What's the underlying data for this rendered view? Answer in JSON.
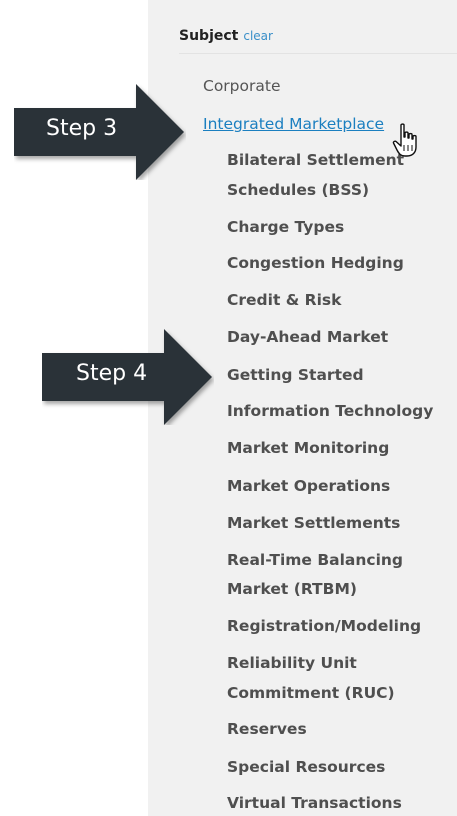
{
  "subject": {
    "title": "Subject",
    "clear_label": "clear"
  },
  "items": {
    "corporate": "Corporate",
    "integrated_marketplace": "Integrated Marketplace",
    "bss_line1": "Bilateral Settlement",
    "bss_line2": "Schedules (BSS)",
    "charge_types": "Charge Types",
    "congestion_hedging": "Congestion Hedging",
    "credit_risk": "Credit & Risk",
    "day_ahead": "Day-Ahead Market",
    "getting_started": "Getting Started",
    "info_tech": "Information Technology",
    "market_monitoring": "Market Monitoring",
    "market_operations": "Market Operations",
    "market_settlements": "Market Settlements",
    "rtbm_line1": "Real-Time Balancing",
    "rtbm_line2": "Market (RTBM)",
    "registration": "Registration/Modeling",
    "ruc_line1": "Reliability Unit",
    "ruc_line2": "Commitment (RUC)",
    "reserves": "Reserves",
    "special_resources": "Special Resources",
    "virtual_transactions": "Virtual Transactions"
  },
  "callouts": {
    "step3": "Step 3",
    "step4": "Step 4"
  },
  "colors": {
    "link": "#1b7fc0",
    "callout": "#2b3339",
    "panel_bg": "#f1f1f1"
  }
}
